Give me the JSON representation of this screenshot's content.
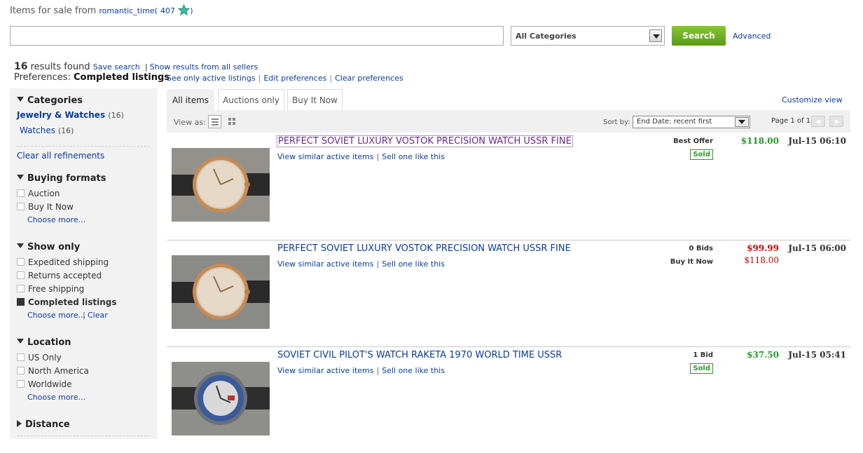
{
  "header": {
    "prefix": "Items for sale from",
    "seller": "romantic_time",
    "open_paren": "(",
    "feedback": "407",
    "close_paren": ")"
  },
  "search": {
    "value": "",
    "category": "All Categories",
    "button": "Search",
    "advanced": "Advanced"
  },
  "results": {
    "count": "16",
    "label": "results found",
    "save_search": "Save search",
    "pipe": "|",
    "show_all": "Show results from all sellers"
  },
  "preferences": {
    "label": "Preferences:",
    "value": "Completed listings",
    "links": [
      "See only active listings",
      "Edit preferences",
      "Clear preferences"
    ],
    "sep": "|"
  },
  "sidebar": {
    "categories_head": "Categories",
    "cat1": {
      "label": "Jewelry & Watches",
      "count": "(16)"
    },
    "cat2": {
      "label": "Watches",
      "count": "(16)"
    },
    "clear_all": "Clear all refinements",
    "buying_head": "Buying formats",
    "buying": [
      "Auction",
      "Buy It Now"
    ],
    "show_head": "Show only",
    "show": [
      "Expedited shipping",
      "Returns accepted",
      "Free shipping",
      "Completed listings"
    ],
    "location_head": "Location",
    "location": [
      "US Only",
      "North America",
      "Worldwide"
    ],
    "choose_more": "Choose more...",
    "clear": "Clear",
    "pipe": "|",
    "distance_head": "Distance"
  },
  "tabs": [
    "All items",
    "Auctions only",
    "Buy It Now"
  ],
  "customize": "Customize view",
  "viewbar": {
    "view_as": "View as:",
    "sort_label": "Sort by:",
    "sort_value": "End Date: recent first",
    "page": "Page 1 of 1"
  },
  "listings": [
    {
      "title": "PERFECT SOVIET LUXURY VOSTOK PRECISION WATCH USSR FINE",
      "similar": "View similar active items",
      "sell": "Sell one like this",
      "sep": "|",
      "format": "Best Offer",
      "badge": "Sold",
      "price": "$118.00",
      "date": "Jul-15 06:10"
    },
    {
      "title": "PERFECT SOVIET LUXURY VOSTOK PRECISION WATCH USSR FINE",
      "similar": "View similar active items",
      "sell": "Sell one like this",
      "sep": "|",
      "format": "0 Bids",
      "format2": "Buy It Now",
      "price": "$99.99",
      "price2": "$118.00",
      "date": "Jul-15 06:00"
    },
    {
      "title": "SOVIET CIVIL PILOT'S WATCH RAKETA 1970 WORLD TIME USSR",
      "similar": "View similar active items",
      "sell": "Sell one like this",
      "sep": "|",
      "format": "1 Bid",
      "badge": "Sold",
      "price": "$37.50",
      "date": "Jul-15 05:41"
    }
  ],
  "colors": {
    "link": "#0a3c9a",
    "price_sold": "#229922",
    "price_unsold": "#cc0000",
    "search_button": "#6aa922"
  },
  "icons": [
    "star-icon",
    "dropdown-arrow-icon",
    "list-view-icon",
    "grid-view-icon",
    "prev-page-icon",
    "next-page-icon",
    "triangle-down-icon",
    "triangle-right-icon"
  ]
}
